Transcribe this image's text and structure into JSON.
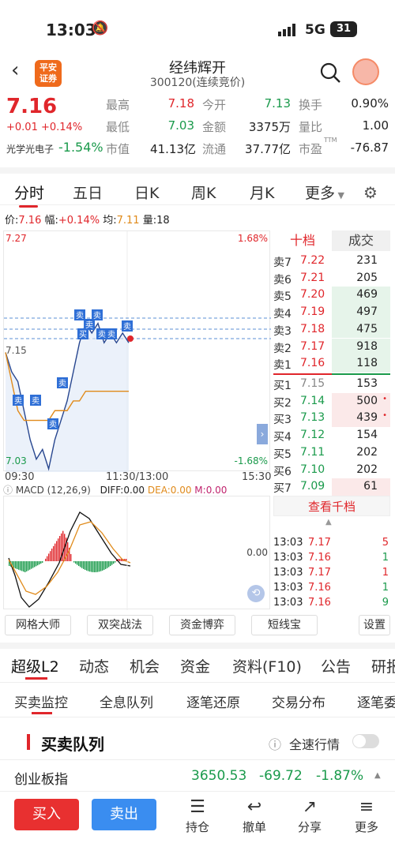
{
  "status": {
    "time": "13:03",
    "network": "5G",
    "battery": "31"
  },
  "header": {
    "brand_line1": "平安",
    "brand_line2": "证券",
    "name": "经纬辉开",
    "code": "300120(连续竞价)"
  },
  "quote": {
    "price": "7.16",
    "change": "+0.01",
    "change_pct": "+0.14%",
    "sector": "光学光电子",
    "sector_pct": "-1.54%",
    "high_label": "最高",
    "high": "7.18",
    "open_label": "今开",
    "open": "7.13",
    "turnover_label": "换手",
    "turnover": "0.90%",
    "low_label": "最低",
    "low": "7.03",
    "amount_label": "金额",
    "amount": "3375万",
    "vol_ratio_label": "量比",
    "vol_ratio": "1.00",
    "mcap_label": "市值",
    "mcap": "41.13亿",
    "float_label": "流通",
    "float": "37.77亿",
    "pe_label": "市盈",
    "pe_sup": "TTM",
    "pe": "-76.87"
  },
  "chart_tabs": [
    "分时",
    "五日",
    "日K",
    "周K",
    "月K",
    "更多"
  ],
  "chart_info": {
    "price_label": "价:",
    "price": "7.16",
    "range_label": "幅:",
    "range": "+0.14%",
    "avg_label": "均:",
    "avg": "7.11",
    "vol_label": "量:",
    "vol": "18"
  },
  "chart_axes": {
    "top_left": "7.27",
    "top_right": "1.68%",
    "mid_left": "7.15",
    "bottom_left": "7.03",
    "bottom_right": "-1.68%",
    "t_start": "09:30",
    "t_mid": "11:30/13:00",
    "t_end": "15:30"
  },
  "chart_data": {
    "type": "line",
    "series": [
      {
        "values": [
          7.15,
          7.13,
          7.12,
          7.09,
          7.06,
          7.04,
          7.05,
          7.03,
          7.06,
          7.08,
          7.1,
          7.13,
          7.16,
          7.18,
          7.17,
          7.18,
          7.16,
          7.17,
          7.16,
          7.17,
          7.16
        ]
      },
      {
        "values": [
          7.15,
          7.12,
          7.09,
          7.08,
          7.08,
          7.08,
          7.08,
          7.08,
          7.09,
          7.09,
          7.09,
          7.1,
          7.1,
          7.11,
          7.11,
          7.11,
          7.11,
          7.11,
          7.11,
          7.11,
          7.11
        ]
      }
    ],
    "ylim": [
      7.03,
      7.27
    ]
  },
  "trade_marks": [
    "卖",
    "卖",
    "卖",
    "卖",
    "卖",
    "卖",
    "买",
    "卖",
    "卖",
    "卖",
    "卖"
  ],
  "macd": {
    "title": "MACD (12,26,9)",
    "diff": "DIFF:0.00",
    "dea": "DEA:0.00",
    "m": "M:0.00",
    "zero": "0.00"
  },
  "orderbook": {
    "tab_active": "十档",
    "tab_other": "成交",
    "more": "查看千档",
    "asks": [
      {
        "label": "卖7",
        "price": "7.22",
        "vol": "231"
      },
      {
        "label": "卖6",
        "price": "7.21",
        "vol": "205"
      },
      {
        "label": "卖5",
        "price": "7.20",
        "vol": "469"
      },
      {
        "label": "卖4",
        "price": "7.19",
        "vol": "497"
      },
      {
        "label": "卖3",
        "price": "7.18",
        "vol": "475"
      },
      {
        "label": "卖2",
        "price": "7.17",
        "vol": "918"
      },
      {
        "label": "卖1",
        "price": "7.16",
        "vol": "118"
      }
    ],
    "bids": [
      {
        "label": "买1",
        "price": "7.15",
        "vol": "153"
      },
      {
        "label": "买2",
        "price": "7.14",
        "vol": "500"
      },
      {
        "label": "买3",
        "price": "7.13",
        "vol": "439"
      },
      {
        "label": "买4",
        "price": "7.12",
        "vol": "154"
      },
      {
        "label": "买5",
        "price": "7.11",
        "vol": "202"
      },
      {
        "label": "买6",
        "price": "7.10",
        "vol": "202"
      },
      {
        "label": "买7",
        "price": "7.09",
        "vol": "61"
      }
    ],
    "ticks": [
      {
        "time": "13:03",
        "price": "7.17",
        "vol": "5"
      },
      {
        "time": "13:03",
        "price": "7.16",
        "vol": "1"
      },
      {
        "time": "13:03",
        "price": "7.17",
        "vol": "1"
      },
      {
        "time": "13:03",
        "price": "7.16",
        "vol": "1"
      },
      {
        "time": "13:03",
        "price": "7.16",
        "vol": "9"
      }
    ]
  },
  "tools": [
    "网格大师",
    "双突战法",
    "资金博弈",
    "短线宝",
    "设置"
  ],
  "section_tabs": [
    "超级L2",
    "动态",
    "机会",
    "资金",
    "资料(F10)",
    "公告",
    "研报"
  ],
  "sub_tabs": [
    "买卖监控",
    "全息队列",
    "逐笔还原",
    "交易分布",
    "逐笔委"
  ],
  "queue": {
    "title": "买卖队列",
    "fast_label": "全速行情"
  },
  "index": {
    "name": "创业板指",
    "value": "3650.53",
    "change": "-69.72",
    "pct": "-1.87%"
  },
  "bottom": {
    "buy": "买入",
    "sell": "卖出",
    "hold": "持仓",
    "cancel": "撤单",
    "share": "分享",
    "more": "更多"
  }
}
